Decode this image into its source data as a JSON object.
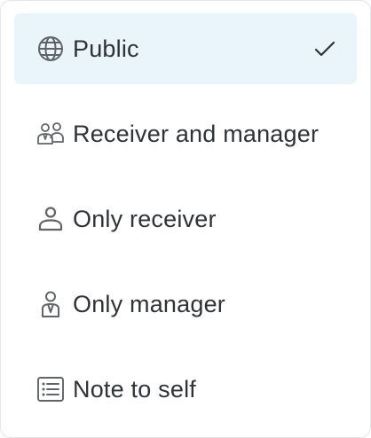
{
  "menu": {
    "options": [
      {
        "label": "Public",
        "icon": "globe-icon",
        "selected": true
      },
      {
        "label": "Receiver and manager",
        "icon": "receiver-and-manager-icon",
        "selected": false
      },
      {
        "label": "Only receiver",
        "icon": "person-icon",
        "selected": false
      },
      {
        "label": "Only manager",
        "icon": "manager-icon",
        "selected": false
      },
      {
        "label": "Note to self",
        "icon": "note-list-icon",
        "selected": false
      }
    ]
  },
  "colors": {
    "text": "#2f3337",
    "icon": "#5f6468",
    "selected_bg": "#eaf4fb",
    "check": "#2f3337",
    "border": "#e4e6ea"
  }
}
